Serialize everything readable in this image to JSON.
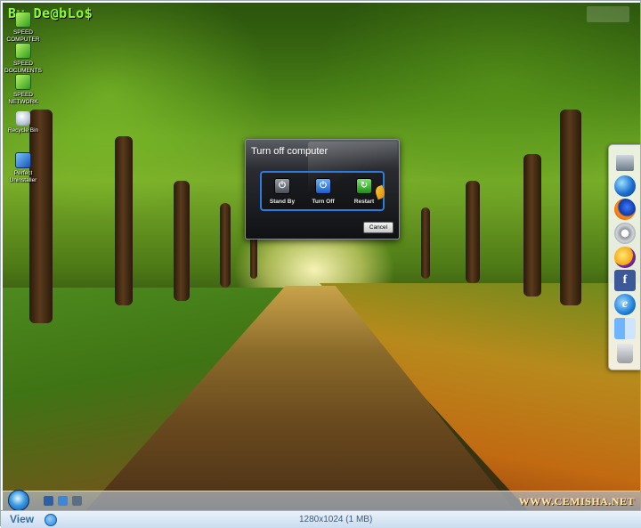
{
  "watermark": "By De@bLo$",
  "desktop_icons": [
    {
      "label_line1": "SPEED",
      "label_line2": "COMPUTER",
      "icon": "speed-computer-icon"
    },
    {
      "label_line1": "SPEED",
      "label_line2": "DOCUMENTS",
      "icon": "speed-documents-icon"
    },
    {
      "label_line1": "SPEED",
      "label_line2": "NETWORK",
      "icon": "speed-network-icon"
    },
    {
      "label_line1": "Recycle Bin",
      "label_line2": "",
      "icon": "recycle-bin-icon"
    },
    {
      "label_line1": "Perfect",
      "label_line2": "Uninstaller",
      "icon": "perfect-uninstaller-icon"
    }
  ],
  "dialog": {
    "title": "Turn off computer",
    "buttons": [
      {
        "label": "Stand By",
        "icon": "standby-icon"
      },
      {
        "label": "Turn Off",
        "icon": "power-icon"
      },
      {
        "label": "Restart",
        "icon": "restart-icon"
      }
    ],
    "cancel_label": "Cancel"
  },
  "dock": {
    "items": [
      {
        "name": "computer-icon"
      },
      {
        "name": "globe-icon"
      },
      {
        "name": "firefox-icon"
      },
      {
        "name": "gear-icon"
      },
      {
        "name": "messenger-icon"
      },
      {
        "name": "facebook-icon",
        "glyph": "f"
      },
      {
        "name": "internet-explorer-icon",
        "glyph": "e"
      },
      {
        "name": "finder-icon"
      },
      {
        "name": "trash-icon"
      }
    ]
  },
  "taskbar": {
    "site_watermark": "WWW.CEMISHA.NET"
  },
  "viewer": {
    "view_label": "View",
    "dimensions": "1280x1024 (1 MB)"
  },
  "colors": {
    "dialog_accent": "#2e7be0",
    "watermark": "#8dff30",
    "viewer_bar": "#c9dcef"
  }
}
